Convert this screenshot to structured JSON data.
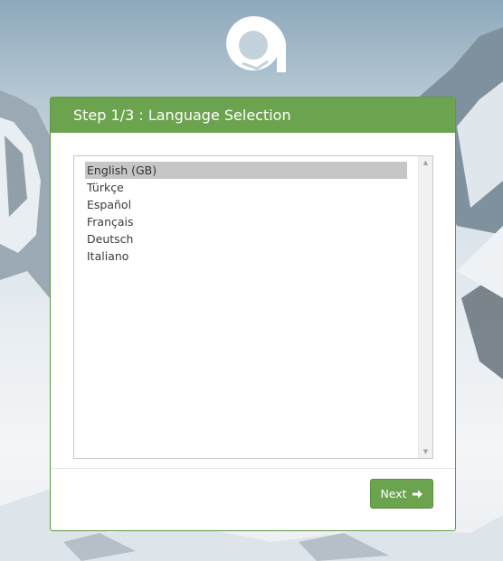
{
  "header": {
    "title": "Step 1/3 : Language Selection"
  },
  "language_list": {
    "items": [
      {
        "label": "English (GB)",
        "selected": true
      },
      {
        "label": "Türkçe",
        "selected": false
      },
      {
        "label": "Español",
        "selected": false
      },
      {
        "label": "Français",
        "selected": false
      },
      {
        "label": "Deutsch",
        "selected": false
      },
      {
        "label": "Italiano",
        "selected": false
      }
    ]
  },
  "footer": {
    "next_label": "Next"
  },
  "icons": {
    "logo": "brand-logo",
    "next": "arrow-right-icon",
    "scroll_up": "scroll-up-icon",
    "scroll_down": "scroll-down-icon"
  },
  "colors": {
    "accent": "#6ca34e",
    "selected_item": "#c6c6c6"
  }
}
